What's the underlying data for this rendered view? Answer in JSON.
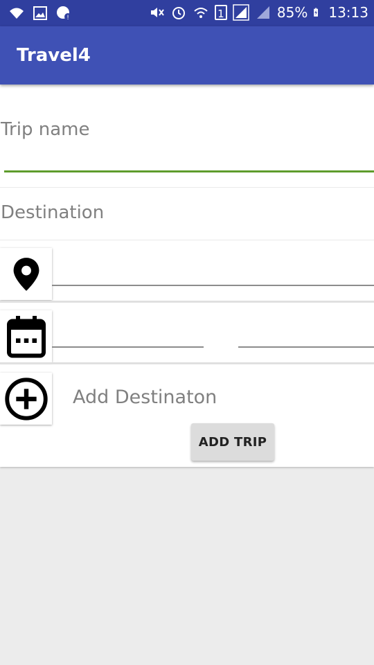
{
  "status_bar": {
    "battery": "85%",
    "time": "13:13",
    "sim_slot": "1",
    "left_icons": [
      "wifi-icon",
      "image-icon",
      "chat-icon"
    ],
    "right_icons": [
      "mute-icon",
      "alarm-icon",
      "wifi-calling-icon",
      "sim-icon",
      "signal-icon",
      "signal-icon",
      "battery-charging-icon"
    ]
  },
  "app_bar": {
    "title": "Travel4",
    "color": "#3f51b5",
    "status_color": "#303f9f"
  },
  "form": {
    "trip_name_label": "Trip name",
    "trip_name_value": "",
    "destination_label": "Destination",
    "location_value": "",
    "start_date_value": "",
    "end_date_value": "",
    "add_destination_label": "Add Destinaton",
    "add_trip_button": "ADD TRIP",
    "focus_color": "#5e9c2c"
  },
  "icons": {
    "location": "map-pin-icon",
    "calendar": "calendar-icon",
    "add": "add-circle-icon"
  }
}
